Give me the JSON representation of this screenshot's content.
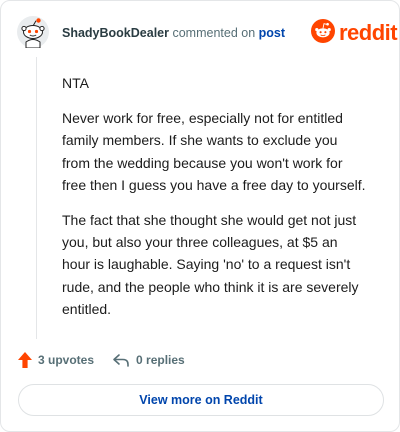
{
  "header": {
    "username": "ShadyBookDealer",
    "action_text": "commented on",
    "link_text": "post",
    "brand_name": "reddit",
    "avatar_icon": "snoo-avatar-icon",
    "brand_icon": "reddit-logo-icon"
  },
  "comment": {
    "paragraphs": [
      "NTA",
      "Never work for free, especially not for entitled family members. If she wants to exclude you from the wedding because you won't work for free then I guess you have a free day to yourself.",
      "The fact that she thought she would get not just you, but also your three colleagues, at $5 an hour is laughable. Saying 'no' to a request isn't rude, and the people who think it is are severely entitled."
    ]
  },
  "actions": {
    "upvotes_label": "3 upvotes",
    "replies_label": "0 replies",
    "upvote_icon": "upvote-arrow-icon",
    "reply_icon": "reply-arrow-icon"
  },
  "footer": {
    "view_more_label": "View more on Reddit"
  },
  "colors": {
    "brand": "#ff4500",
    "link": "#0045ac",
    "muted": "#576f76",
    "text": "#1c1c1c",
    "border": "#e4e6e8"
  }
}
